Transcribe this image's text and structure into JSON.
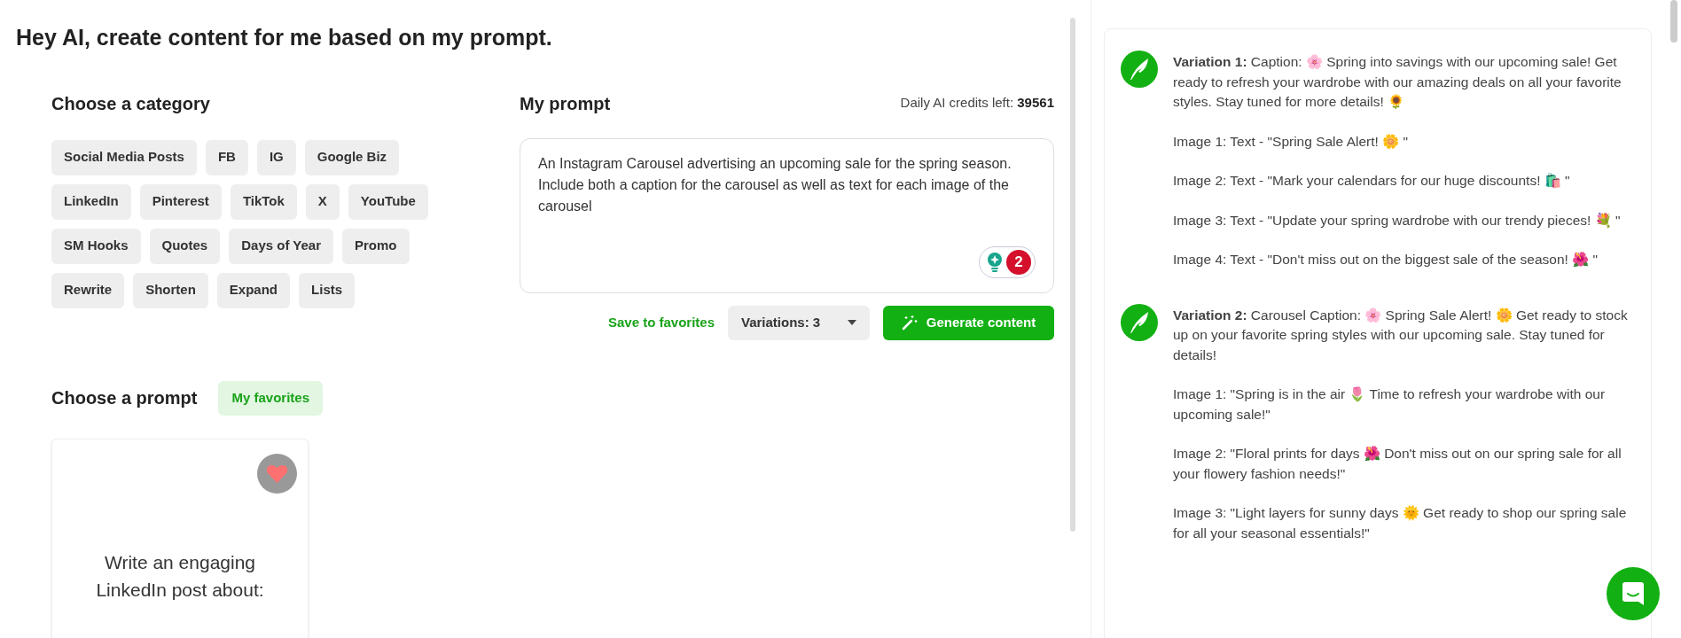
{
  "heading": "Hey AI, create content for me based on my prompt.",
  "categories": {
    "title": "Choose a category",
    "chips": [
      {
        "label": "Social Media Posts",
        "selected": false
      },
      {
        "label": "FB",
        "selected": false
      },
      {
        "label": "IG",
        "selected": false
      },
      {
        "label": "Google Biz",
        "selected": false
      },
      {
        "label": "LinkedIn",
        "selected": false
      },
      {
        "label": "Pinterest",
        "selected": false
      },
      {
        "label": "TikTok",
        "selected": false
      },
      {
        "label": "X",
        "selected": false
      },
      {
        "label": "YouTube",
        "selected": false
      },
      {
        "label": "SM Hooks",
        "selected": false
      },
      {
        "label": "Quotes",
        "selected": false
      },
      {
        "label": "Days of Year",
        "selected": false
      },
      {
        "label": "Promo",
        "selected": false
      },
      {
        "label": "Rewrite",
        "selected": false
      },
      {
        "label": "Shorten",
        "selected": false
      },
      {
        "label": "Expand",
        "selected": false
      },
      {
        "label": "Lists",
        "selected": false
      }
    ]
  },
  "prompt_picker": {
    "title": "Choose a prompt",
    "favorites_button": "My favorites",
    "cards": [
      {
        "text": "Write an engaging LinkedIn post about:",
        "favorite": true
      }
    ]
  },
  "my_prompt": {
    "title": "My prompt",
    "credits_label": "Daily AI credits left:",
    "credits_value": "39561",
    "value": "An Instagram Carousel advertising an upcoming sale for the spring season. Include both a caption for the carousel as well as text for each image of the carousel",
    "suggestions_count": "2",
    "save_link": "Save to favorites",
    "variations_select": "Variations: 3",
    "generate_button": "Generate content"
  },
  "results": [
    {
      "paragraphs": [
        "**Variation 1:**  Caption: 🌸 Spring into savings with our upcoming sale! Get ready to refresh your wardrobe with our amazing deals on all your favorite styles. Stay tuned for more details! 🌻",
        "Image 1: Text - \"Spring Sale Alert! 🌼 \"",
        "Image 2: Text - \"Mark your calendars for our huge discounts! 🛍️ \"",
        "Image 3: Text - \"Update your spring wardrobe with our trendy pieces! 💐 \"",
        "Image 4: Text - \"Don't miss out on the biggest sale of the season! 🌺 \""
      ]
    },
    {
      "paragraphs": [
        "**Variation 2:**  Carousel Caption: 🌸 Spring Sale Alert! 🌼 Get ready to stock up on your favorite spring styles with our upcoming sale. Stay tuned for details!",
        "Image 1: \"Spring is in the air 🌷 Time to refresh your wardrobe with our upcoming sale!\"",
        "Image 2: \"Floral prints for days 🌺 Don't miss out on our spring sale for all your flowery fashion needs!\"",
        "Image 3: \"Light layers for sunny days 🌞 Get ready to shop our spring sale for all your seasonal essentials!\""
      ]
    }
  ]
}
